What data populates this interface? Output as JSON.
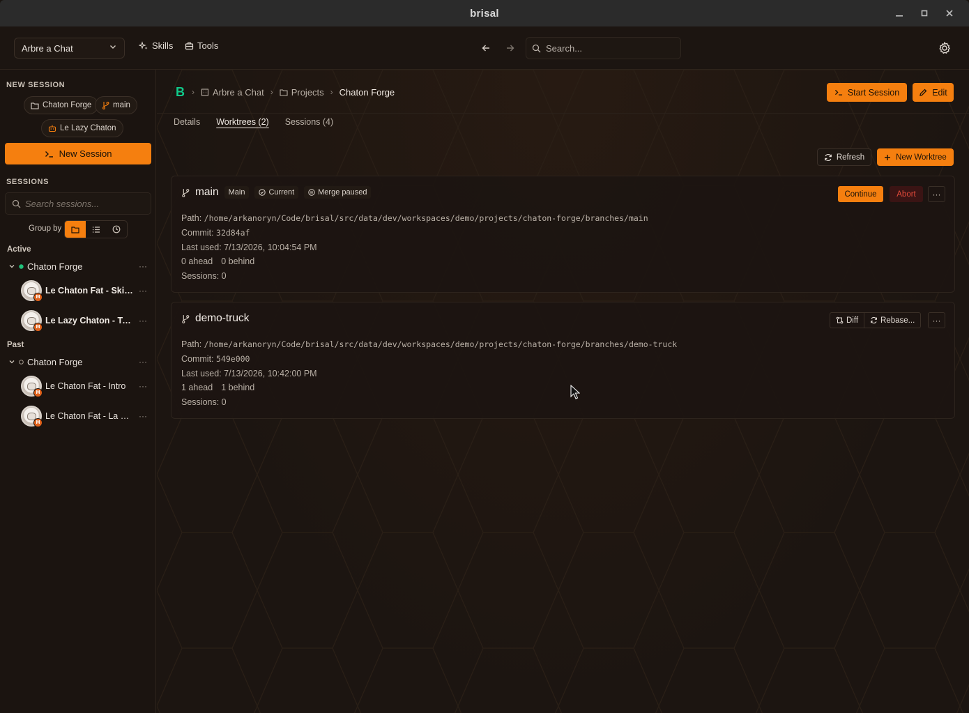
{
  "window": {
    "title": "brisal"
  },
  "toolbar": {
    "workspace": "Arbre a Chat",
    "skills_label": "Skills",
    "tools_label": "Tools",
    "search_placeholder": "Search..."
  },
  "sidebar": {
    "new_session_heading": "NEW SESSION",
    "chips": {
      "project": "Chaton Forge",
      "branch": "main",
      "agent": "Le Lazy Chaton"
    },
    "new_session_button": "New Session",
    "sessions_heading": "SESSIONS",
    "search_placeholder": "Search sessions...",
    "group_by_label": "Group by",
    "active_label": "Active",
    "past_label": "Past",
    "active_project": "Chaton Forge",
    "active_sessions": [
      {
        "name": "Le Chaton Fat - Skill..."
      },
      {
        "name": "Le Lazy Chaton - To..."
      }
    ],
    "past_project": "Chaton Forge",
    "past_sessions": [
      {
        "name": "Le Chaton Fat - Intro"
      },
      {
        "name": "Le Chaton Fat - La Fo..."
      }
    ],
    "avatar_badge": "M"
  },
  "main": {
    "breadcrumb": {
      "logo": "B",
      "workspace": "Arbre a Chat",
      "projects": "Projects",
      "current": "Chaton Forge"
    },
    "start_session_label": "Start Session",
    "edit_label": "Edit",
    "tabs": [
      "Details",
      "Worktrees (2)",
      "Sessions (4)"
    ],
    "refresh_label": "Refresh",
    "new_worktree_label": "New Worktree",
    "worktrees": [
      {
        "branch": "main",
        "tag": "Main",
        "status_current": "Current",
        "status_merge": "Merge paused",
        "path_label": "Path:",
        "path": "/home/arkanoryn/Code/brisal/src/data/dev/workspaces/demo/projects/chaton-forge/branches/main",
        "commit_label": "Commit:",
        "commit": "32d84af",
        "last_used": "Last used: 7/13/2026, 10:04:54 PM",
        "ahead": "0 ahead",
        "behind": "0 behind",
        "sessions": "Sessions: 0",
        "continue_label": "Continue",
        "abort_label": "Abort"
      },
      {
        "branch": "demo-truck",
        "path_label": "Path:",
        "path": "/home/arkanoryn/Code/brisal/src/data/dev/workspaces/demo/projects/chaton-forge/branches/demo-truck",
        "commit_label": "Commit:",
        "commit": "549e000",
        "last_used": "Last used: 7/13/2026, 10:42:00 PM",
        "ahead": "1 ahead",
        "behind": "1 behind",
        "sessions": "Sessions: 0",
        "diff_label": "Diff",
        "rebase_label": "Rebase..."
      }
    ]
  },
  "colors": {
    "accent": "#f57f0f",
    "active_dot": "#20c07a",
    "logo": "#10c98a",
    "abort": "#e04a3a"
  }
}
